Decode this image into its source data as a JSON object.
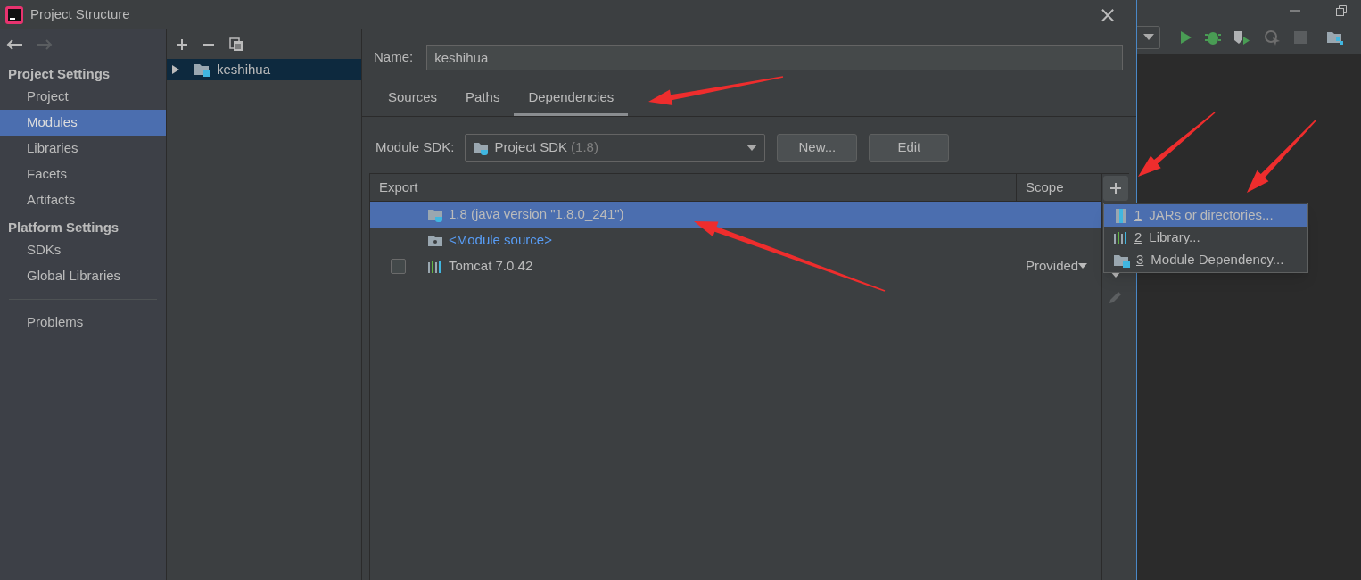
{
  "window": {
    "title": "Project Structure",
    "close": "×"
  },
  "sidebar": {
    "groups": [
      {
        "title": "Project Settings",
        "items": [
          {
            "label": "Project",
            "selected": false
          },
          {
            "label": "Modules",
            "selected": true
          },
          {
            "label": "Libraries",
            "selected": false
          },
          {
            "label": "Facets",
            "selected": false
          },
          {
            "label": "Artifacts",
            "selected": false
          }
        ]
      },
      {
        "title": "Platform Settings",
        "items": [
          {
            "label": "SDKs",
            "selected": false
          },
          {
            "label": "Global Libraries",
            "selected": false
          }
        ]
      }
    ],
    "extra_items": [
      {
        "label": "Problems",
        "selected": false
      }
    ]
  },
  "module_tree": {
    "items": [
      {
        "label": "keshihua",
        "selected": true,
        "expanded": false
      }
    ]
  },
  "name_field": {
    "label": "Name:",
    "value": "keshihua"
  },
  "tabs": [
    {
      "label": "Sources",
      "selected": false
    },
    {
      "label": "Paths",
      "selected": false
    },
    {
      "label": "Dependencies",
      "selected": true
    }
  ],
  "module_sdk": {
    "label": "Module SDK:",
    "value": "Project SDK",
    "hint": "(1.8)",
    "buttons": [
      "New...",
      "Edit"
    ]
  },
  "table": {
    "columns": [
      "Export",
      "Scope"
    ],
    "rows": [
      {
        "kind": "sdk",
        "label": "1.8 (java version \"1.8.0_241\")",
        "selected": true
      },
      {
        "kind": "source",
        "label": "<Module source>",
        "selected": false
      },
      {
        "kind": "library",
        "label": "Tomcat 7.0.42",
        "selected": false,
        "checked": false,
        "scope": "Provided"
      }
    ]
  },
  "add_menu": [
    {
      "kind": "jars",
      "mnemonic": "1",
      "label": "JARs or directories...",
      "selected": true
    },
    {
      "kind": "library",
      "mnemonic": "2",
      "label": "Library...",
      "selected": false
    },
    {
      "kind": "module",
      "mnemonic": "3",
      "label": "Module Dependency...",
      "selected": false
    }
  ]
}
